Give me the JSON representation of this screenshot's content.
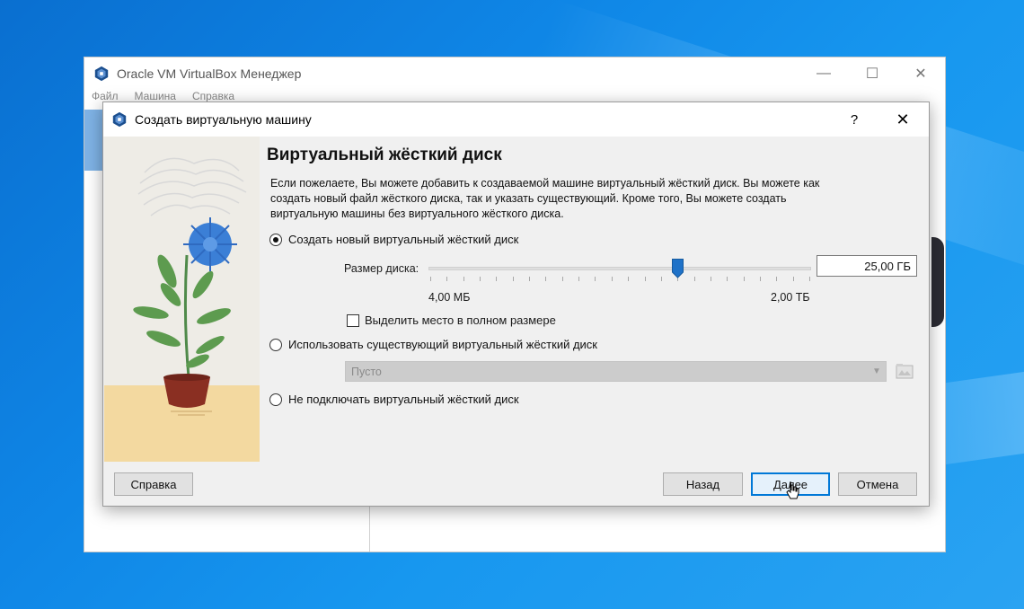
{
  "manager": {
    "title": "Oracle VM VirtualBox Менеджер",
    "menu": [
      "Файл",
      "Машина",
      "Справка"
    ],
    "window_controls": [
      "minimize-icon",
      "maximize-icon",
      "close-icon"
    ]
  },
  "dialog": {
    "title": "Создать виртуальную машину",
    "help_label": "?",
    "close_label": "✕",
    "heading": "Виртуальный жёсткий диск",
    "description": "Если пожелаете, Вы можете добавить к создаваемой машине виртуальный жёсткий диск. Вы можете как создать новый файл жёсткого диска, так и указать существующий. Кроме того, Вы можете создать виртуальную машины без виртуального жёсткого диска.",
    "options": {
      "create_new": {
        "label": "Создать новый виртуальный жёсткий диск",
        "selected": true
      },
      "use_existing": {
        "label": "Использовать существующий виртуальный жёсткий диск",
        "selected": false
      },
      "no_disk": {
        "label": "Не подключать виртуальный жёсткий диск",
        "selected": false
      }
    },
    "disk_size": {
      "label": "Размер диска:",
      "value": "25,00 ГБ",
      "min_label": "4,00 МБ",
      "max_label": "2,00 ТБ",
      "slider_fraction": 0.65,
      "tick_count": 24
    },
    "preallocate": {
      "label": "Выделить место в полном размере",
      "checked": false
    },
    "existing_combo": {
      "value": "Пусто",
      "enabled": false
    },
    "buttons": {
      "help": "Справка",
      "back": "Назад",
      "next": "Далее",
      "cancel": "Отмена"
    }
  },
  "colors": {
    "accent": "#0078d7",
    "thumb": "#1f72c8",
    "flower": "#3b7fd6",
    "pot": "#8a2f22",
    "desktop": "#0f86e6"
  }
}
